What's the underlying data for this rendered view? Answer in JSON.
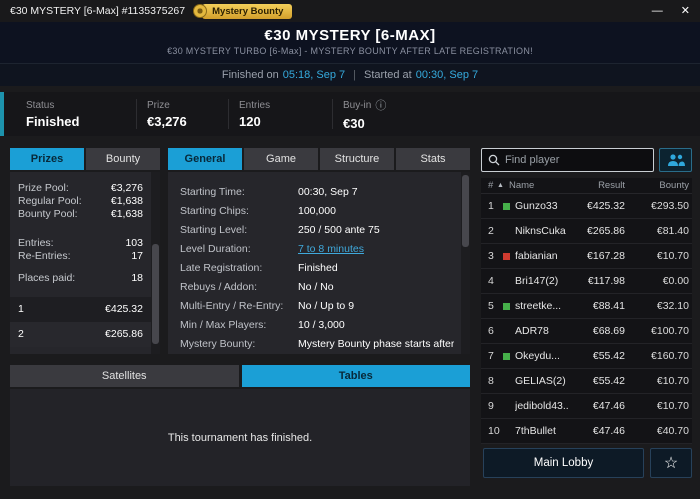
{
  "titlebar": {
    "title": "€30 MYSTERY [6-Max] #1135375267",
    "badge": "Mystery Bounty"
  },
  "icons": {
    "minimize": "—",
    "close": "✕",
    "info": "ⓘ",
    "sort_asc": "▲",
    "star": "☆",
    "separator": "|"
  },
  "header": {
    "title": "€30 MYSTERY [6-MAX]",
    "subtitle": "€30 MYSTERY TURBO [6-Max] - MYSTERY BOUNTY AFTER LATE REGISTRATION!",
    "finished_label": "Finished on",
    "finished_time": "05:18, Sep 7",
    "started_label": "Started at",
    "started_time": "00:30, Sep 7"
  },
  "status_bar": {
    "items": [
      {
        "label": "Status",
        "value": "Finished"
      },
      {
        "label": "Prize",
        "value": "€3,276"
      },
      {
        "label": "Entries",
        "value": "120"
      },
      {
        "label": "Buy-in",
        "value": "€30"
      }
    ]
  },
  "left_panel": {
    "tabs": [
      {
        "label": "Prizes"
      },
      {
        "label": "Bounty"
      }
    ],
    "rows": [
      {
        "label": "Prize Pool:",
        "value": "€3,276"
      },
      {
        "label": "Regular Pool:",
        "value": "€1,638"
      },
      {
        "label": "Bounty Pool:",
        "value": "€1,638"
      },
      {
        "label": "Entries:",
        "value": "103"
      },
      {
        "label": "Re-Entries:",
        "value": "17"
      },
      {
        "label": "Places paid:",
        "value": "18"
      }
    ],
    "payouts": [
      {
        "place": "1",
        "amount": "€425.32"
      },
      {
        "place": "2",
        "amount": "€265.86"
      }
    ]
  },
  "info_panel": {
    "tabs": [
      {
        "label": "General"
      },
      {
        "label": "Game"
      },
      {
        "label": "Structure"
      },
      {
        "label": "Stats"
      }
    ],
    "rows": [
      {
        "label": "Starting Time:",
        "value": "00:30, Sep 7"
      },
      {
        "label": "Starting Chips:",
        "value": "100,000"
      },
      {
        "label": "Starting Level:",
        "value": "250 / 500 ante 75"
      },
      {
        "label": "Level Duration:",
        "value": "7 to 8 minutes"
      },
      {
        "label": "Late Registration:",
        "value": "Finished"
      },
      {
        "label": "Rebuys / Addon:",
        "value": "No / No"
      },
      {
        "label": "Multi-Entry / Re-Entry:",
        "value": "No / Up to 9"
      },
      {
        "label": "Min / Max Players:",
        "value": "10 / 3,000"
      },
      {
        "label": "Mystery Bounty:",
        "value": "Mystery Bounty phase starts after the end of"
      }
    ]
  },
  "bottom_panel": {
    "tabs": [
      {
        "label": "Satellites"
      },
      {
        "label": "Tables"
      }
    ],
    "message": "This tournament has finished."
  },
  "players_panel": {
    "search_placeholder": "Find player",
    "columns": {
      "rank": "#",
      "name": "Name",
      "result": "Result",
      "bounty": "Bounty"
    },
    "rows": [
      {
        "rank": "1",
        "dot": "green",
        "name": "Gunzo33",
        "result": "€425.32",
        "bounty": "€293.50"
      },
      {
        "rank": "2",
        "dot": "none",
        "name": "NiknsCuka",
        "result": "€265.86",
        "bounty": "€81.40"
      },
      {
        "rank": "3",
        "dot": "red",
        "name": "fabianian",
        "result": "€167.28",
        "bounty": "€10.70"
      },
      {
        "rank": "4",
        "dot": "none",
        "name": "Bri147(2)",
        "result": "€117.98",
        "bounty": "€0.00"
      },
      {
        "rank": "5",
        "dot": "green",
        "name": "streetke...",
        "result": "€88.41",
        "bounty": "€32.10"
      },
      {
        "rank": "6",
        "dot": "none",
        "name": "ADR78",
        "result": "€68.69",
        "bounty": "€100.70"
      },
      {
        "rank": "7",
        "dot": "green",
        "name": "Okeydu...",
        "result": "€55.42",
        "bounty": "€160.70"
      },
      {
        "rank": "8",
        "dot": "none",
        "name": "GELIAS(2)",
        "result": "€55.42",
        "bounty": "€10.70"
      },
      {
        "rank": "9",
        "dot": "none",
        "name": "jedibold43...",
        "result": "€47.46",
        "bounty": "€10.70"
      },
      {
        "rank": "10",
        "dot": "none",
        "name": "7thBullet",
        "result": "€47.46",
        "bounty": "€40.70"
      }
    ],
    "main_lobby_label": "Main Lobby"
  },
  "colors": {
    "accent_cyan": "#1b9fd6",
    "badge_gold": "#e3b83e",
    "status_green": "#46b04a",
    "status_red": "#cf3b30",
    "link_blue": "#3fa9dc"
  }
}
